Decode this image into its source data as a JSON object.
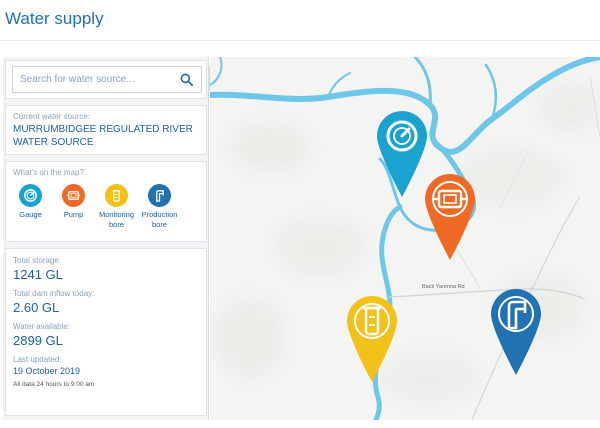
{
  "page": {
    "title": "Water supply"
  },
  "search": {
    "placeholder": "Search for water source..."
  },
  "source": {
    "label": "Current water source:",
    "name": "MURRUMBIDGEE REGULATED RIVER WATER SOURCE"
  },
  "legend": {
    "title": "What's on the map?",
    "items": [
      {
        "label": "Gauge",
        "icon": "gauge-icon",
        "color": "#1aa3cf"
      },
      {
        "label": "Pump",
        "icon": "pump-icon",
        "color": "#f06a25"
      },
      {
        "label": "Monitoring bore",
        "icon": "monitoring-bore-icon",
        "color": "#f2c21b"
      },
      {
        "label": "Production bore",
        "icon": "production-bore-icon",
        "color": "#2272b2"
      }
    ]
  },
  "stats": {
    "total_storage_label": "Total storage:",
    "total_storage_value": "1241 GL",
    "inflow_label": "Total dam inflow today:",
    "inflow_value": "2.60 GL",
    "available_label": "Water available:",
    "available_value": "2899 GL",
    "updated_label": "Last updated:",
    "updated_value": "19 October 2019",
    "note": "All data 24 hours to 9:00 am"
  },
  "map": {
    "road_label": "Back Yarenna Rd"
  },
  "colors": {
    "river": "#6ec6e8",
    "accent": "#1f6fb7"
  }
}
